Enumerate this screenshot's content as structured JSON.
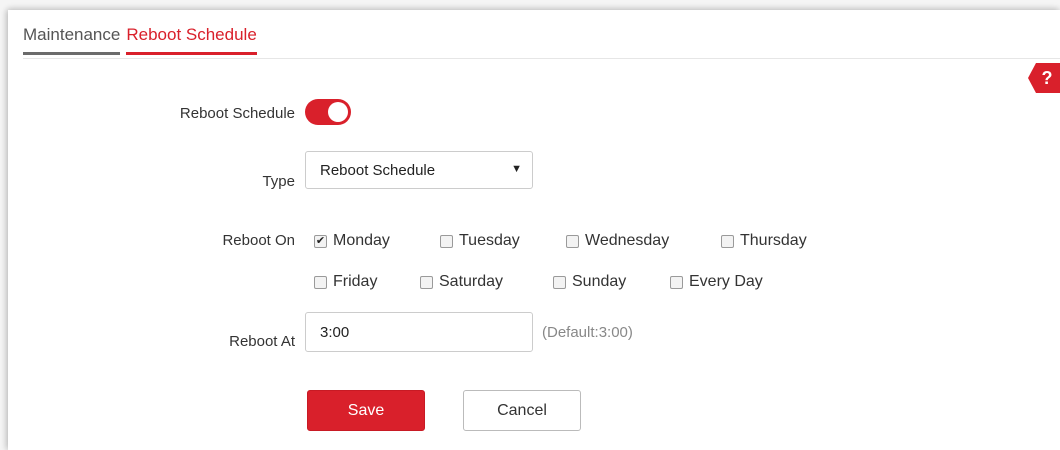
{
  "tabs": [
    {
      "label": "Maintenance",
      "active": false
    },
    {
      "label": "Reboot Schedule",
      "active": true
    }
  ],
  "help": {
    "icon": "question-icon",
    "label": "?"
  },
  "form": {
    "schedule_label": "Reboot Schedule",
    "schedule_enabled": true,
    "type_label": "Type",
    "type_value": "Reboot Schedule",
    "reboot_on_label": "Reboot On",
    "days": [
      {
        "label": "Monday",
        "checked": true
      },
      {
        "label": "Tuesday",
        "checked": false
      },
      {
        "label": "Wednesday",
        "checked": false
      },
      {
        "label": "Thursday",
        "checked": false
      },
      {
        "label": "Friday",
        "checked": false
      },
      {
        "label": "Saturday",
        "checked": false
      },
      {
        "label": "Sunday",
        "checked": false
      },
      {
        "label": "Every Day",
        "checked": false
      }
    ],
    "reboot_at_label": "Reboot At",
    "reboot_at_value": "3:00",
    "reboot_at_hint": "(Default:3:00)"
  },
  "buttons": {
    "save": "Save",
    "cancel": "Cancel"
  },
  "colors": {
    "accent": "#d9202b",
    "inactive_tab": "#6b6b6b"
  }
}
